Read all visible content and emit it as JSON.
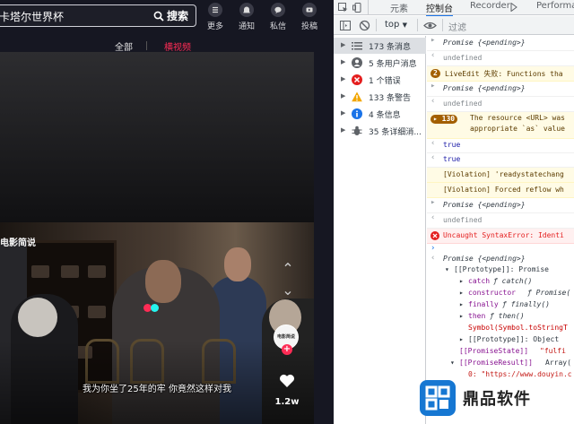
{
  "app": {
    "search": {
      "value": "卡塔尔世界杯",
      "button": "搜索"
    },
    "toolbar": [
      {
        "label": "更多",
        "icon": "more-icon"
      },
      {
        "label": "通知",
        "icon": "bell-icon"
      },
      {
        "label": "私信",
        "icon": "message-icon"
      },
      {
        "label": "投稿",
        "icon": "upload-icon"
      }
    ],
    "feed_tabs": {
      "all": "全部",
      "landscape": "横视频"
    },
    "video": {
      "watermark": "电影简说",
      "subtitle": "我为你坐了25年的牢  你竟然这样对我",
      "author_badge": "电影简说",
      "follow": "+",
      "likes": "1.2w",
      "nav_up": "⌃",
      "nav_down": "⌄"
    },
    "colors": {
      "accent": "#fe2c55",
      "background": "#161722"
    }
  },
  "devtools": {
    "tabs": [
      "元素",
      "控制台",
      "Recorder",
      "Performance"
    ],
    "active_tab": "控制台",
    "toolbar": {
      "context": "top",
      "filter_placeholder": "过滤"
    },
    "sidebar": [
      {
        "label": "173 条消息",
        "icon": "list-icon"
      },
      {
        "label": "5 条用户消息",
        "icon": "user-icon"
      },
      {
        "label": "1 个错误",
        "icon": "error-icon"
      },
      {
        "label": "133 条警告",
        "icon": "warning-icon"
      },
      {
        "label": "4 条信息",
        "icon": "info-icon"
      },
      {
        "label": "35 条详细消...",
        "icon": "bug-icon"
      }
    ],
    "console": {
      "l1": "Promise {<pending>}",
      "l2": "undefined",
      "l3_badge": "2",
      "l3": "LiveEdit 失败: Functions tha",
      "l4": "Promise {<pending>}",
      "l5": "undefined",
      "l6_badge": "130",
      "l6a": "The resource <URL> was",
      "l6b": "appropriate `as` value",
      "l7": "true",
      "l8": "true",
      "l9": "[Violation] 'readystatechang",
      "l10": "[Violation] Forced reflow wh",
      "l11": "Promise {<pending>}",
      "l12": "undefined",
      "l13": "Uncaught SyntaxError: Identi",
      "p_head": "Promise {<pending>}",
      "p_proto": "[[Prototype]]: Promise",
      "p_catch_k": "catch",
      "p_catch_v": "ƒ catch()",
      "p_ctor_k": "constructor",
      "p_ctor_v": "ƒ Promise(",
      "p_finally_k": "finally",
      "p_finally_v": "ƒ finally()",
      "p_then_k": "then",
      "p_then_v": "ƒ then()",
      "p_symbol": "Symbol(Symbol.toStringT",
      "p_proto2": "[[Prototype]]: Object",
      "p_state_k": "[[PromiseState]]",
      "p_state_v": "\"fulfi",
      "p_result_k": "[[PromiseResult]]",
      "p_result_v": "Array(",
      "p_zero": "0: \"https://www.douyin.c"
    }
  },
  "brand": {
    "name": "鼎品软件"
  }
}
